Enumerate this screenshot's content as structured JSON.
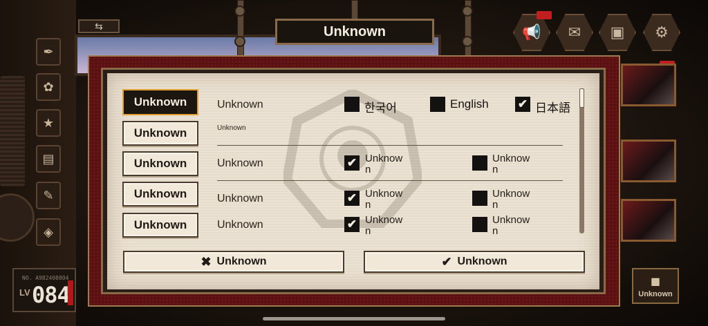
{
  "header": {
    "title": "Unknown",
    "back_icon": "swap-arrows-icon"
  },
  "player": {
    "id": "A982408804",
    "level_label": "LV",
    "level": "084"
  },
  "top_icons": [
    "megaphone-icon",
    "mail-icon",
    "folder-icon",
    "gear-icon"
  ],
  "bottom_right_button": {
    "label": "Unknown",
    "icon": "bookshelf-icon"
  },
  "dialog": {
    "rows": [
      {
        "button": "Unknown",
        "label": "Unknown",
        "active": true
      },
      {
        "button": "Unknown",
        "sub": "Unknown"
      },
      {
        "button": "Unknown",
        "label": "Unknown",
        "opt1": "Unknow\nn",
        "opt1_checked": true,
        "opt2": "Unknow\nn",
        "opt2_checked": false
      },
      {
        "button": "Unknown",
        "label": "Unknown",
        "opt1": "Unknow\nn",
        "opt1_checked": true,
        "opt2": "Unknow\nn",
        "opt2_checked": false
      },
      {
        "button": "Unknown",
        "label": "Unknown",
        "opt1": "Unknow\nn",
        "opt1_checked": true,
        "opt2": "Unknow\nn",
        "opt2_checked": false
      }
    ],
    "languages": [
      {
        "label": "한국어",
        "checked": false
      },
      {
        "label": "English",
        "checked": false
      },
      {
        "label": "日本語",
        "checked": true
      }
    ],
    "cancel": {
      "label": "Unknown",
      "icon": "close-icon"
    },
    "confirm": {
      "label": "Unknown",
      "icon": "check-icon"
    }
  },
  "colors": {
    "active_border": "#e3a133",
    "paper": "#ece2d3",
    "frame_red": "#5a1111"
  }
}
